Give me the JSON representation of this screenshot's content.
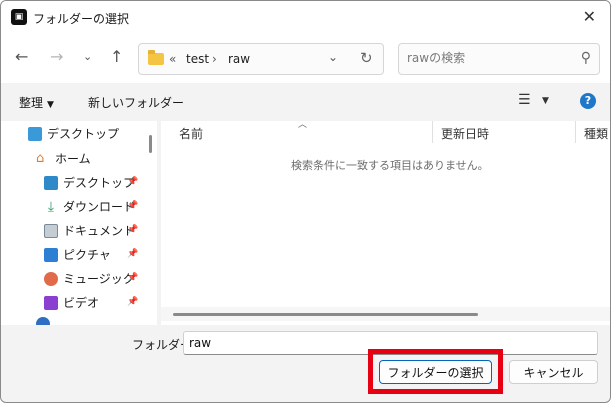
{
  "window": {
    "title": "フォルダーの選択"
  },
  "nav": {
    "breadcrumb": [
      "test",
      "raw"
    ],
    "search_placeholder": "rawの検索"
  },
  "commands": {
    "organize_label": "整理",
    "new_folder_label": "新しいフォルダー"
  },
  "sidebar": {
    "items": [
      {
        "label": "デスクトップ",
        "icon": "desktop-icon",
        "color": "#3a9ad9",
        "pinned": false
      },
      {
        "label": "ホーム",
        "icon": "home-icon",
        "color": "#e07a2e",
        "pinned": false
      },
      {
        "label": "デスクトップ",
        "icon": "desktop-icon",
        "color": "#2f88c7",
        "pinned": true
      },
      {
        "label": "ダウンロード",
        "icon": "download-icon",
        "color": "#2e9e6b",
        "pinned": true
      },
      {
        "label": "ドキュメント",
        "icon": "document-icon",
        "color": "#7a8a99",
        "pinned": true
      },
      {
        "label": "ピクチャ",
        "icon": "pictures-icon",
        "color": "#2d7fd3",
        "pinned": true
      },
      {
        "label": "ミュージック",
        "icon": "music-icon",
        "color": "#e06a4a",
        "pinned": true
      },
      {
        "label": "ビデオ",
        "icon": "video-icon",
        "color": "#8a3fd1",
        "pinned": true
      }
    ]
  },
  "file_list": {
    "columns": [
      "名前",
      "更新日時",
      "種類"
    ],
    "empty_message": "検索条件に一致する項目はありません。"
  },
  "footer": {
    "folder_label": "フォルダー:",
    "folder_value": "raw",
    "select_button": "フォルダーの選択",
    "cancel_button": "キャンセル"
  },
  "colors": {
    "accent": "#0067c0",
    "highlight": "#e60012"
  }
}
